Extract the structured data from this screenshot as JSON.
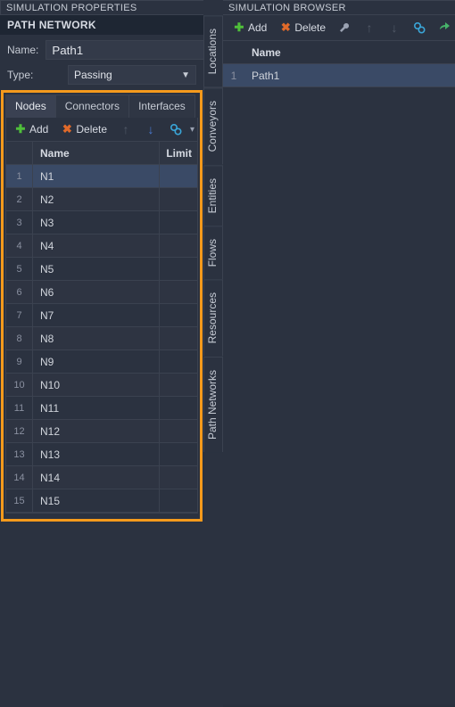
{
  "left_panel": {
    "title": "SIMULATION PROPERTIES",
    "section": "PATH NETWORK",
    "name_label": "Name:",
    "name_value": "Path1",
    "type_label": "Type:",
    "type_value": "Passing",
    "tabs": {
      "nodes": "Nodes",
      "connectors": "Connectors",
      "interfaces": "Interfaces"
    },
    "toolbar": {
      "add": "Add",
      "delete": "Delete"
    },
    "columns": {
      "name": "Name",
      "limit": "Limit"
    },
    "nodes": [
      {
        "n": "1",
        "name": "N1"
      },
      {
        "n": "2",
        "name": "N2"
      },
      {
        "n": "3",
        "name": "N3"
      },
      {
        "n": "4",
        "name": "N4"
      },
      {
        "n": "5",
        "name": "N5"
      },
      {
        "n": "6",
        "name": "N6"
      },
      {
        "n": "7",
        "name": "N7"
      },
      {
        "n": "8",
        "name": "N8"
      },
      {
        "n": "9",
        "name": "N9"
      },
      {
        "n": "10",
        "name": "N10"
      },
      {
        "n": "11",
        "name": "N11"
      },
      {
        "n": "12",
        "name": "N12"
      },
      {
        "n": "13",
        "name": "N13"
      },
      {
        "n": "14",
        "name": "N14"
      },
      {
        "n": "15",
        "name": "N15"
      }
    ]
  },
  "right_panel": {
    "title": "SIMULATION BROWSER",
    "toolbar": {
      "add": "Add",
      "delete": "Delete"
    },
    "columns": {
      "name": "Name"
    },
    "rows": [
      {
        "n": "1",
        "name": "Path1"
      }
    ],
    "vtabs": [
      "Locations",
      "Conveyors",
      "Entities",
      "Flows",
      "Resources",
      "Path Networks"
    ]
  }
}
